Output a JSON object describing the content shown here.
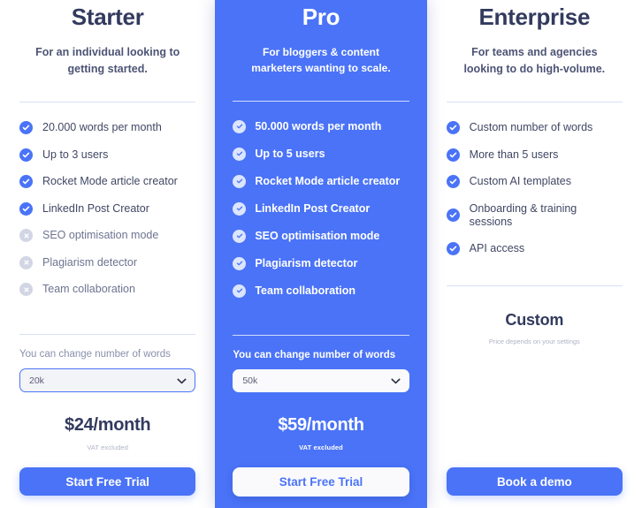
{
  "colors": {
    "accent": "#4a73f7",
    "featured_bg": "#4a73f7",
    "heading": "#323a5e",
    "body_text": "#404764",
    "muted_text": "#8a90ab",
    "divider": "#d6e2f5",
    "icon_on": "#4a73f7",
    "icon_off": "#d2d6e4",
    "card_bg": "#ffffff"
  },
  "plans": [
    {
      "name": "Starter",
      "description": "For an individual looking to getting started.",
      "featured": false,
      "features": [
        {
          "label": "20.000 words per month",
          "included": true,
          "icon": "check-circle-icon"
        },
        {
          "label": "Up to 3 users",
          "included": true,
          "icon": "check-circle-icon"
        },
        {
          "label": "Rocket Mode article creator",
          "included": true,
          "icon": "check-circle-icon"
        },
        {
          "label": "LinkedIn Post Creator",
          "included": true,
          "icon": "check-circle-icon"
        },
        {
          "label": "SEO optimisation mode",
          "included": false,
          "icon": "x-circle-icon"
        },
        {
          "label": "Plagiarism detector",
          "included": false,
          "icon": "x-circle-icon"
        },
        {
          "label": "Team collaboration",
          "included": false,
          "icon": "x-circle-icon"
        }
      ],
      "words_label": "You can change number of words",
      "words_value": "20k",
      "words_options": [
        "20k"
      ],
      "price": "$24/month",
      "vat_note": "VAT excluded",
      "cta_label": "Start Free Trial"
    },
    {
      "name": "Pro",
      "description": "For bloggers & content marketers wanting to scale.",
      "featured": true,
      "features": [
        {
          "label": "50.000 words per month",
          "included": true,
          "icon": "check-circle-icon"
        },
        {
          "label": "Up to 5 users",
          "included": true,
          "icon": "check-circle-icon"
        },
        {
          "label": "Rocket Mode article creator",
          "included": true,
          "icon": "check-circle-icon"
        },
        {
          "label": "LinkedIn Post Creator",
          "included": true,
          "icon": "check-circle-icon"
        },
        {
          "label": "SEO optimisation mode",
          "included": true,
          "icon": "check-circle-icon"
        },
        {
          "label": "Plagiarism detector",
          "included": true,
          "icon": "check-circle-icon"
        },
        {
          "label": "Team collaboration",
          "included": true,
          "icon": "check-circle-icon"
        }
      ],
      "words_label": "You can change number of words",
      "words_value": "50k",
      "words_options": [
        "50k"
      ],
      "price": "$59/month",
      "vat_note": "VAT excluded",
      "cta_label": "Start Free Trial"
    },
    {
      "name": "Enterprise",
      "description": "For teams and agencies looking to do high-volume.",
      "featured": false,
      "features": [
        {
          "label": "Custom number of words",
          "included": true,
          "icon": "check-circle-icon"
        },
        {
          "label": "More than 5 users",
          "included": true,
          "icon": "check-circle-icon"
        },
        {
          "label": "Custom AI templates",
          "included": true,
          "icon": "check-circle-icon"
        },
        {
          "label": "Onboarding & training sessions",
          "included": true,
          "icon": "check-circle-icon"
        },
        {
          "label": "API access",
          "included": true,
          "icon": "check-circle-icon"
        }
      ],
      "price": "Custom",
      "price_note": "Price depends on your settings",
      "cta_label": "Book a demo"
    }
  ]
}
